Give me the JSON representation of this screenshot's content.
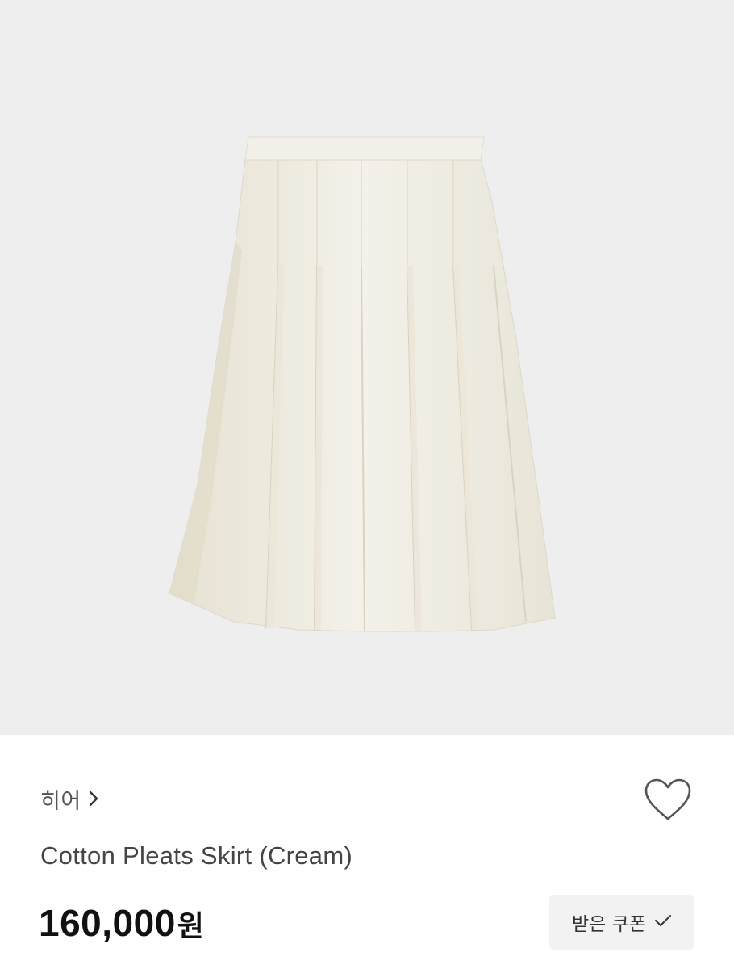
{
  "product": {
    "image_alt": "Cotton Pleats Skirt (Cream)",
    "background_color": "#eeeeee",
    "skirt_color": "#efece2"
  },
  "brand": {
    "name": "히어",
    "icon": "chevron-right-icon"
  },
  "title": "Cotton Pleats Skirt (Cream)",
  "price": {
    "amount": "160,000",
    "unit": "원"
  },
  "wishlist": {
    "icon": "heart-outline-icon"
  },
  "coupon": {
    "label": "받은 쿠폰",
    "icon": "check-icon"
  }
}
